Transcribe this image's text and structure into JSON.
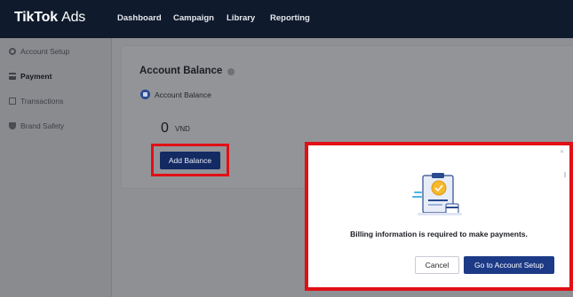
{
  "brand": {
    "name": "TikTok",
    "suffix": "Ads"
  },
  "nav": [
    "Dashboard",
    "Campaign",
    "Library",
    "Reporting"
  ],
  "sidebar": {
    "items": [
      {
        "label": "Account Setup",
        "icon": "gear-icon"
      },
      {
        "label": "Payment",
        "icon": "card-icon",
        "active": true
      },
      {
        "label": "Transactions",
        "icon": "list-icon"
      },
      {
        "label": "Brand Safety",
        "icon": "shield-icon"
      }
    ]
  },
  "balance": {
    "title": "Account Balance",
    "label": "Account Balance",
    "amount": "0",
    "currency": "VND",
    "add_button": "Add Balance"
  },
  "modal": {
    "message": "Billing information is required to make payments.",
    "cancel_label": "Cancel",
    "primary_label": "Go to Account Setup"
  },
  "colors": {
    "nav_bg": "#0f1a2c",
    "primary": "#1c3a86",
    "highlight": "#e10f16"
  }
}
